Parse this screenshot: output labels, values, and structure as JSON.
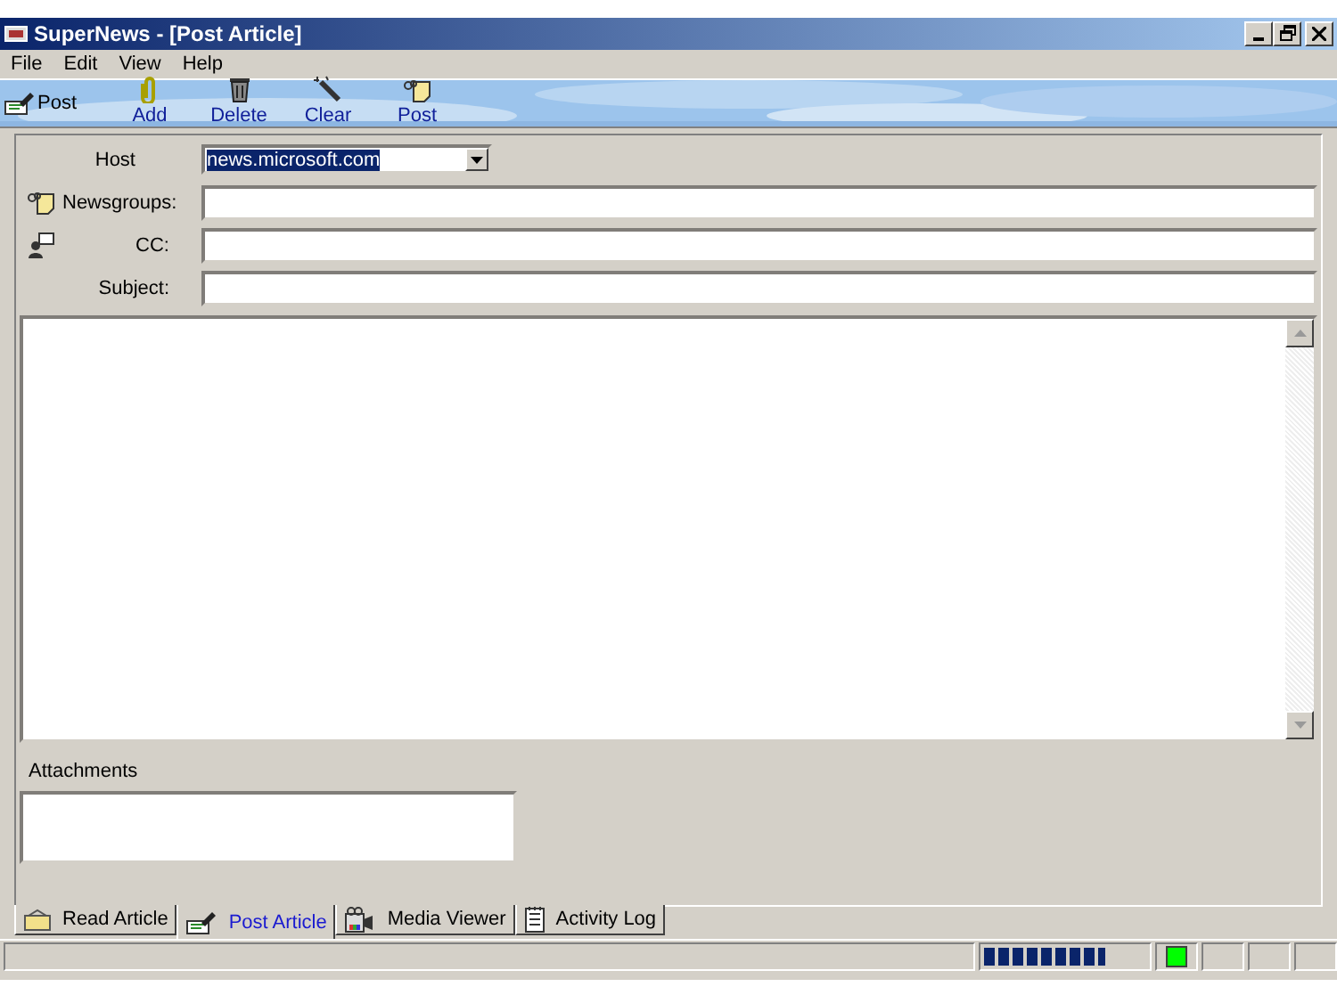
{
  "window": {
    "title": "SuperNews - [Post Article]"
  },
  "menu": [
    {
      "label": "File"
    },
    {
      "label": "Edit"
    },
    {
      "label": "View"
    },
    {
      "label": "Help"
    }
  ],
  "toolbar": [
    {
      "kind": "inline",
      "label": "Post"
    },
    {
      "kind": "stacked",
      "label": "Add"
    },
    {
      "kind": "stacked",
      "label": "Delete"
    },
    {
      "kind": "stacked",
      "label": "Clear"
    },
    {
      "kind": "stacked",
      "label": "Post"
    }
  ],
  "form": {
    "fields": [
      {
        "kind": "combo",
        "label": "Host",
        "value": "news.microsoft.com"
      },
      {
        "kind": "text",
        "label": "Newsgroups:"
      },
      {
        "kind": "text",
        "label": "CC:"
      },
      {
        "kind": "text",
        "label": "Subject:"
      }
    ],
    "attachments_label": "Attachments"
  },
  "tabs": [
    {
      "label": "Read Article",
      "selected": false
    },
    {
      "label": "Post Article",
      "selected": true
    },
    {
      "label": "Media Viewer",
      "selected": false
    },
    {
      "label": "Activity Log",
      "selected": false
    }
  ],
  "status_bar": {
    "progress": {
      "level": 0.75
    },
    "indicator": {
      "on": true
    }
  }
}
